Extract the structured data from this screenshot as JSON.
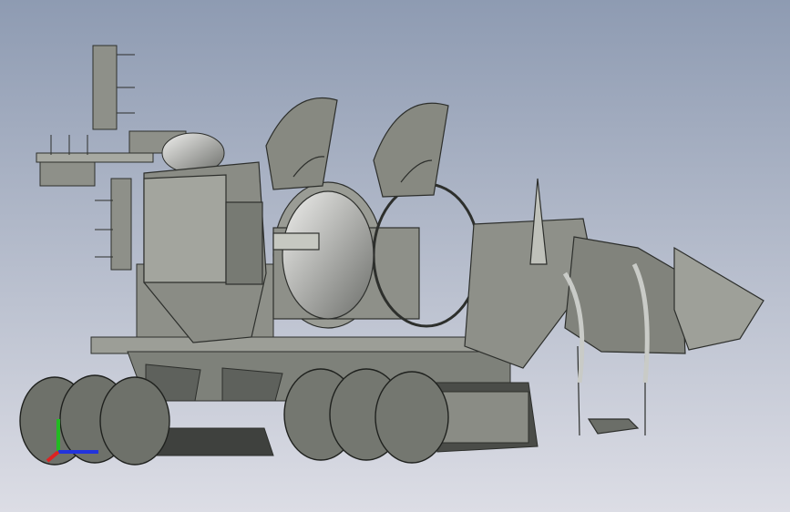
{
  "view": {
    "background": {
      "top": "#8E9BB2",
      "bottom": "#DCDDE5"
    },
    "model_colors": {
      "body": "#8E9089",
      "body_light": "#B4B6AE",
      "body_dark": "#5E615C",
      "edge": "#2D2F2C",
      "metal": "#C9CBC7"
    }
  },
  "triad": {
    "x_color": "#2233DD",
    "y_color": "#22BB22",
    "z_color": "#DD2222"
  }
}
